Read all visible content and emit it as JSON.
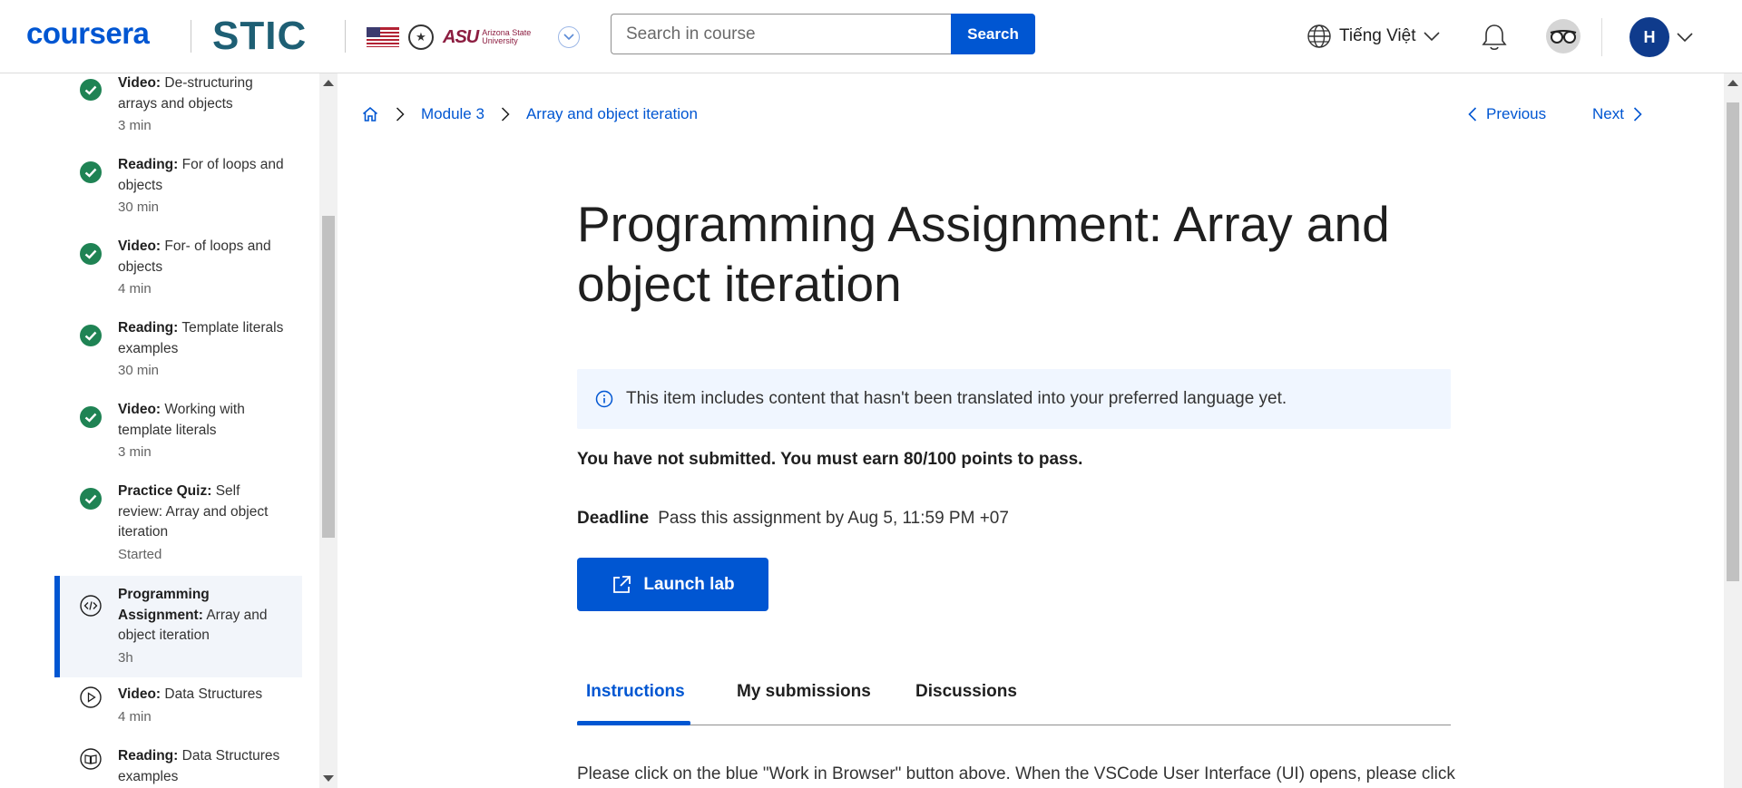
{
  "header": {
    "logo_text": "coursera",
    "org_logo_text": "STIC",
    "asu_mark": "ASU",
    "asu_text": "Arizona State University",
    "search": {
      "placeholder": "Search in course",
      "button_label": "Search"
    },
    "language_label": "Tiếng Việt",
    "user_initial": "H",
    "brand_color": "#0056d2"
  },
  "sidebar": {
    "items": [
      {
        "type": "Video:",
        "title": "De-structuring arrays and objects",
        "duration": "3 min",
        "status": "completed"
      },
      {
        "type": "Reading:",
        "title": "For of loops and objects",
        "duration": "30 min",
        "status": "completed"
      },
      {
        "type": "Video:",
        "title": "For- of loops and objects",
        "duration": "4 min",
        "status": "completed"
      },
      {
        "type": "Reading:",
        "title": "Template literals examples",
        "duration": "30 min",
        "status": "completed"
      },
      {
        "type": "Video:",
        "title": "Working with template literals",
        "duration": "3 min",
        "status": "completed"
      },
      {
        "type": "Practice Quiz:",
        "title": "Self review: Array and object iteration",
        "duration": "Started",
        "status": "completed"
      },
      {
        "type": "Programming Assignment:",
        "title": "Array and object iteration",
        "duration": "3h",
        "status": "active"
      },
      {
        "type": "Video:",
        "title": "Data Structures",
        "duration": "4 min",
        "status": "video"
      },
      {
        "type": "Reading:",
        "title": "Data Structures examples",
        "duration": "",
        "status": "reading"
      }
    ]
  },
  "breadcrumb": {
    "module": "Module 3",
    "page": "Array and object iteration"
  },
  "nav": {
    "previous": "Previous",
    "next": "Next"
  },
  "main": {
    "title": "Programming Assignment: Array and object iteration",
    "notice": "This item includes content that hasn't been translated into your preferred language yet.",
    "status": "You have not submitted. You must earn 80/100 points to pass.",
    "deadline_label": "Deadline",
    "deadline_value": "Pass this assignment by Aug 5, 11:59 PM +07",
    "launch_label": "Launch lab",
    "tabs": [
      {
        "label": "Instructions",
        "active": true
      },
      {
        "label": "My submissions",
        "active": false
      },
      {
        "label": "Discussions",
        "active": false
      }
    ],
    "instructions_text": "Please click on the blue \"Work in Browser\" button above. When the VSCode User Interface (UI) opens, please click"
  },
  "colors": {
    "check_green": "#1f8354",
    "accent": "#0056d2",
    "notice_bg": "#f0f6ff"
  }
}
